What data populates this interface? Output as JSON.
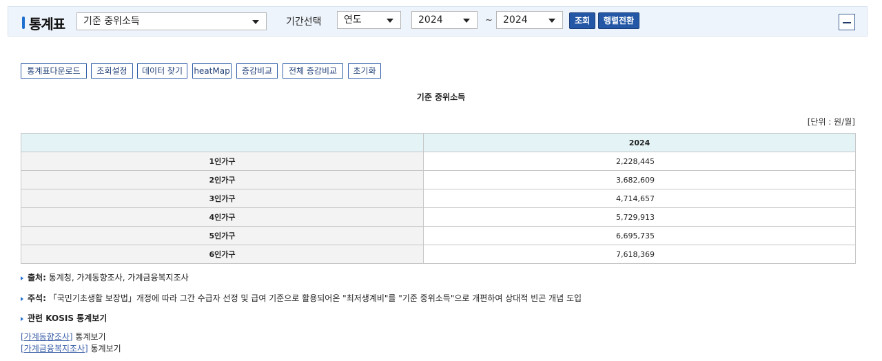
{
  "header": {
    "title": "통계표",
    "table_select": "기준 중위소득",
    "period_label": "기간선택",
    "period_type": "연도",
    "start_year": "2024",
    "end_year": "2024",
    "tilde": "~",
    "search_label": "조회",
    "transpose_label": "행렬전환"
  },
  "toolbar": {
    "download": "통계표다운로드",
    "settings": "조회설정",
    "find_data": "데이터 찾기",
    "heatmap": "heatMap",
    "compare": "증감비교",
    "compare_all": "전체 증감비교",
    "reset": "초기화"
  },
  "table": {
    "title": "기준 중위소득",
    "unit": "[단위 : 원/월]",
    "column_header": "2024",
    "rows": [
      {
        "label": "1인가구",
        "value": "2,228,445"
      },
      {
        "label": "2인가구",
        "value": "3,682,609"
      },
      {
        "label": "3인가구",
        "value": "4,714,657"
      },
      {
        "label": "4인가구",
        "value": "5,729,913"
      },
      {
        "label": "5인가구",
        "value": "6,695,735"
      },
      {
        "label": "6인가구",
        "value": "7,618,369"
      }
    ]
  },
  "notes": {
    "source_label": "출처:",
    "source_text": " 통계청, 가계동향조사, 가계금융복지조사",
    "comment_label": "주석:",
    "comment_text": " 「국민기초생활 보장법」개정에 따라 그간 수급자 선정 및 급여 기준으로 활용되어온 \"최저생계비\"를 \"기준 중위소득\"으로 개편하여 상대적 빈곤 개념 도입",
    "related_label": "관련 KOSIS 통계보기",
    "link1": "[가계동향조사]",
    "link2": "[가계금융복지조사]",
    "link_suffix": " 통계보기"
  },
  "colors": {
    "accent": "#1f6fd1",
    "button_blue": "#2457a6",
    "header_cell": "#e3f3f6"
  }
}
